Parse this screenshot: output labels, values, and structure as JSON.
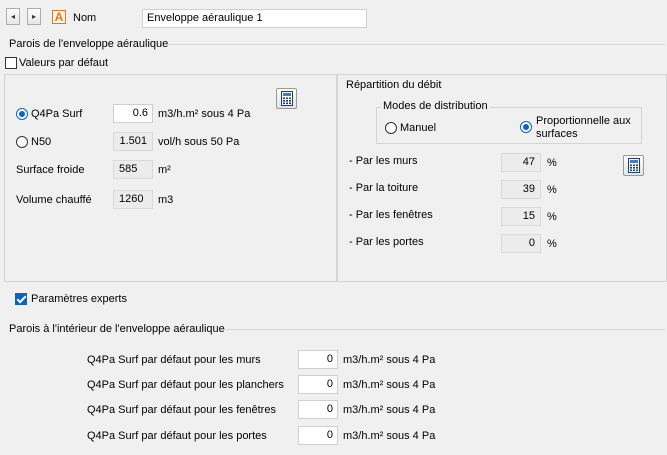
{
  "header": {
    "prev_icon": "◂",
    "next_icon": "▸",
    "type_icon_letter": "A",
    "name_label": "Nom",
    "name_value": "Enveloppe aéraulique 1"
  },
  "envelope": {
    "section_title": "Parois de l'enveloppe aéraulique",
    "default_values_label": "Valeurs par défaut",
    "default_values_checked": false
  },
  "left_panel": {
    "q4pa_label": "Q4Pa Surf",
    "q4pa_value": "0.6",
    "q4pa_unit": "m3/h.m² sous 4 Pa",
    "q4pa_selected": true,
    "n50_label": "N50",
    "n50_value": "1.501",
    "n50_unit": "vol/h sous 50 Pa",
    "n50_selected": false,
    "surface_label": "Surface froide",
    "surface_value": "585",
    "surface_unit": "m²",
    "volume_label": "Volume chauffé",
    "volume_value": "1260",
    "volume_unit": "m3",
    "calculator_icon": "calculator-icon"
  },
  "right_panel": {
    "title": "Répartition du débit",
    "modes_title": "Modes de distribution",
    "mode_manual": "Manuel",
    "mode_proportional_line1": "Proportionnelle aux",
    "mode_proportional_line2": "surfaces",
    "selected_mode": "proportional",
    "rows": [
      {
        "label": "- Par les murs",
        "value": "47",
        "unit": "%"
      },
      {
        "label": "- Par la toiture",
        "value": "39",
        "unit": "%"
      },
      {
        "label": "- Par les fenêtres",
        "value": "15",
        "unit": "%"
      },
      {
        "label": "- Par les portes",
        "value": "0",
        "unit": "%"
      }
    ]
  },
  "experts": {
    "label": "Paramètres experts",
    "checked": true
  },
  "interior": {
    "section_title": "Parois à l'intérieur de l'enveloppe aéraulique",
    "rows": [
      {
        "label": "Q4Pa Surf par défaut pour les murs",
        "value": "0",
        "unit": "m3/h.m² sous 4 Pa"
      },
      {
        "label": "Q4Pa Surf par défaut pour les planchers",
        "value": "0",
        "unit": "m3/h.m² sous 4 Pa"
      },
      {
        "label": "Q4Pa Surf par défaut pour les fenêtres",
        "value": "0",
        "unit": "m3/h.m² sous 4 Pa"
      },
      {
        "label": "Q4Pa Surf par défaut pour les portes",
        "value": "0",
        "unit": "m3/h.m² sous 4 Pa"
      }
    ]
  },
  "colors": {
    "accent": "#0a64c8",
    "icon_orange": "#e07a1a"
  }
}
